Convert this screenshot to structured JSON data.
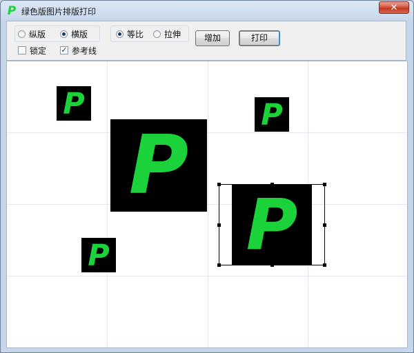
{
  "window": {
    "title": "绿色版图片排版打印",
    "close_glyph": "✕",
    "app_icon_glyph": "P",
    "app_icon_color": "#1bd23a"
  },
  "toolbar": {
    "layout": {
      "portrait_label": "纵版",
      "landscape_label": "横版",
      "selected": "landscape"
    },
    "scale": {
      "proportional_label": "等比",
      "stretch_label": "拉伸",
      "selected": "proportional"
    },
    "lock_label": "锁定",
    "lock_checked": false,
    "guides_label": "参考线",
    "guides_checked": true,
    "check_glyph": "✓",
    "add_label": "增加",
    "print_label": "打印"
  },
  "canvas": {
    "background": "#ffffff",
    "guide_color": "#e4e8ee",
    "image_letter": "P",
    "image_letter_color": "#1bd23a",
    "image_background": "#000000",
    "selected_image_index": 4
  }
}
